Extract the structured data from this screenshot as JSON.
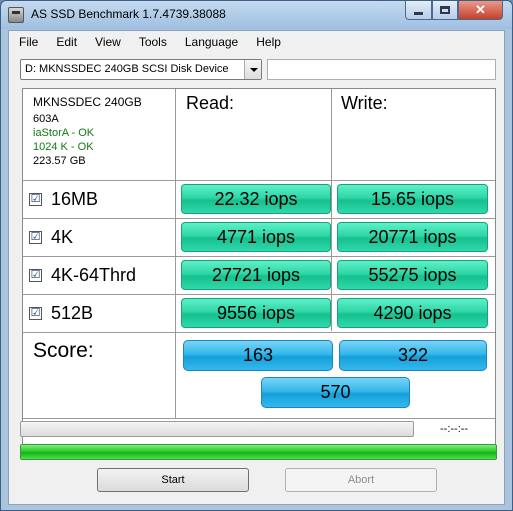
{
  "window": {
    "title": "AS SSD Benchmark 1.7.4739.38088"
  },
  "menu": {
    "items": [
      "File",
      "Edit",
      "View",
      "Tools",
      "Language",
      "Help"
    ]
  },
  "drive": {
    "selected": "D: MKNSSDEC 240GB SCSI Disk Device",
    "extra_value": ""
  },
  "info": {
    "model": "MKNSSDEC 240GB",
    "firmware": "603A",
    "driver": "iaStorA - OK",
    "alignment": "1024 K - OK",
    "capacity": "223.57 GB"
  },
  "headers": {
    "read": "Read:",
    "write": "Write:"
  },
  "tests": [
    {
      "label": "16MB",
      "checked": true,
      "read": "22.32 iops",
      "write": "15.65 iops"
    },
    {
      "label": "4K",
      "checked": true,
      "read": "4771 iops",
      "write": "20771 iops"
    },
    {
      "label": "4K-64Thrd",
      "checked": true,
      "read": "27721 iops",
      "write": "55275 iops"
    },
    {
      "label": "512B",
      "checked": true,
      "read": "9556 iops",
      "write": "4290 iops"
    }
  ],
  "score": {
    "label": "Score:",
    "read": "163",
    "write": "322",
    "total": "570"
  },
  "status": {
    "time": "--:--:--",
    "progress_percent": 0,
    "done_percent": 100
  },
  "buttons": {
    "start": "Start",
    "abort": "Abort"
  },
  "icons": {
    "app": "disk-icon",
    "check": "☑"
  }
}
